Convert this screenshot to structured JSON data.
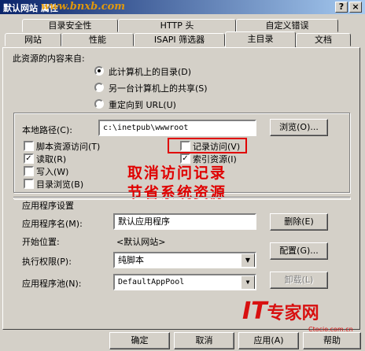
{
  "window": {
    "title": "默认网站 属性",
    "watermark": "www.bnxb.com",
    "help_btn": "?",
    "close_btn": "×"
  },
  "tabs_back": [
    "目录安全性",
    "HTTP 头",
    "自定义错误"
  ],
  "tabs_front": [
    "网站",
    "性能",
    "ISAPI 筛选器",
    "主目录",
    "文档"
  ],
  "source": {
    "heading": "此资源的内容来自:",
    "options": [
      {
        "label": "此计算机上的目录(D)",
        "selected": true
      },
      {
        "label": "另一台计算机上的共享(S)",
        "selected": false
      },
      {
        "label": "重定向到 URL(U)",
        "selected": false
      }
    ]
  },
  "path": {
    "label": "本地路径(C):",
    "value": "c:\\inetpub\\wwwroot",
    "browse": "浏览(O)..."
  },
  "checks": {
    "script_access": {
      "label": "脚本资源访问(T)",
      "checked": false
    },
    "read": {
      "label": "读取(R)",
      "checked": true
    },
    "write": {
      "label": "写入(W)",
      "checked": false
    },
    "dir_browse": {
      "label": "目录浏览(B)",
      "checked": false
    },
    "log_visits": {
      "label": "记录访问(V)",
      "checked": false
    },
    "index": {
      "label": "索引资源(I)",
      "checked": true
    }
  },
  "annotation": {
    "line1": "取消访问记录",
    "line2": "节省系统资源"
  },
  "app": {
    "heading": "应用程序设置",
    "name_label": "应用程序名(M):",
    "name_value": "默认应用程序",
    "remove": "删除(E)",
    "start_label": "开始位置:",
    "start_value": "<默认网站>",
    "exec_label": "执行权限(P):",
    "exec_value": "纯脚本",
    "config": "配置(G)...",
    "pool_label": "应用程序池(N):",
    "pool_value": "DefaultAppPool",
    "unload": "卸载(L)"
  },
  "footer": {
    "ok": "确定",
    "cancel": "取消",
    "apply": "应用(A)",
    "help": "帮助"
  },
  "logo": {
    "it": "IT",
    "name": "专家网",
    "site": "Ctocio.com.cn"
  }
}
